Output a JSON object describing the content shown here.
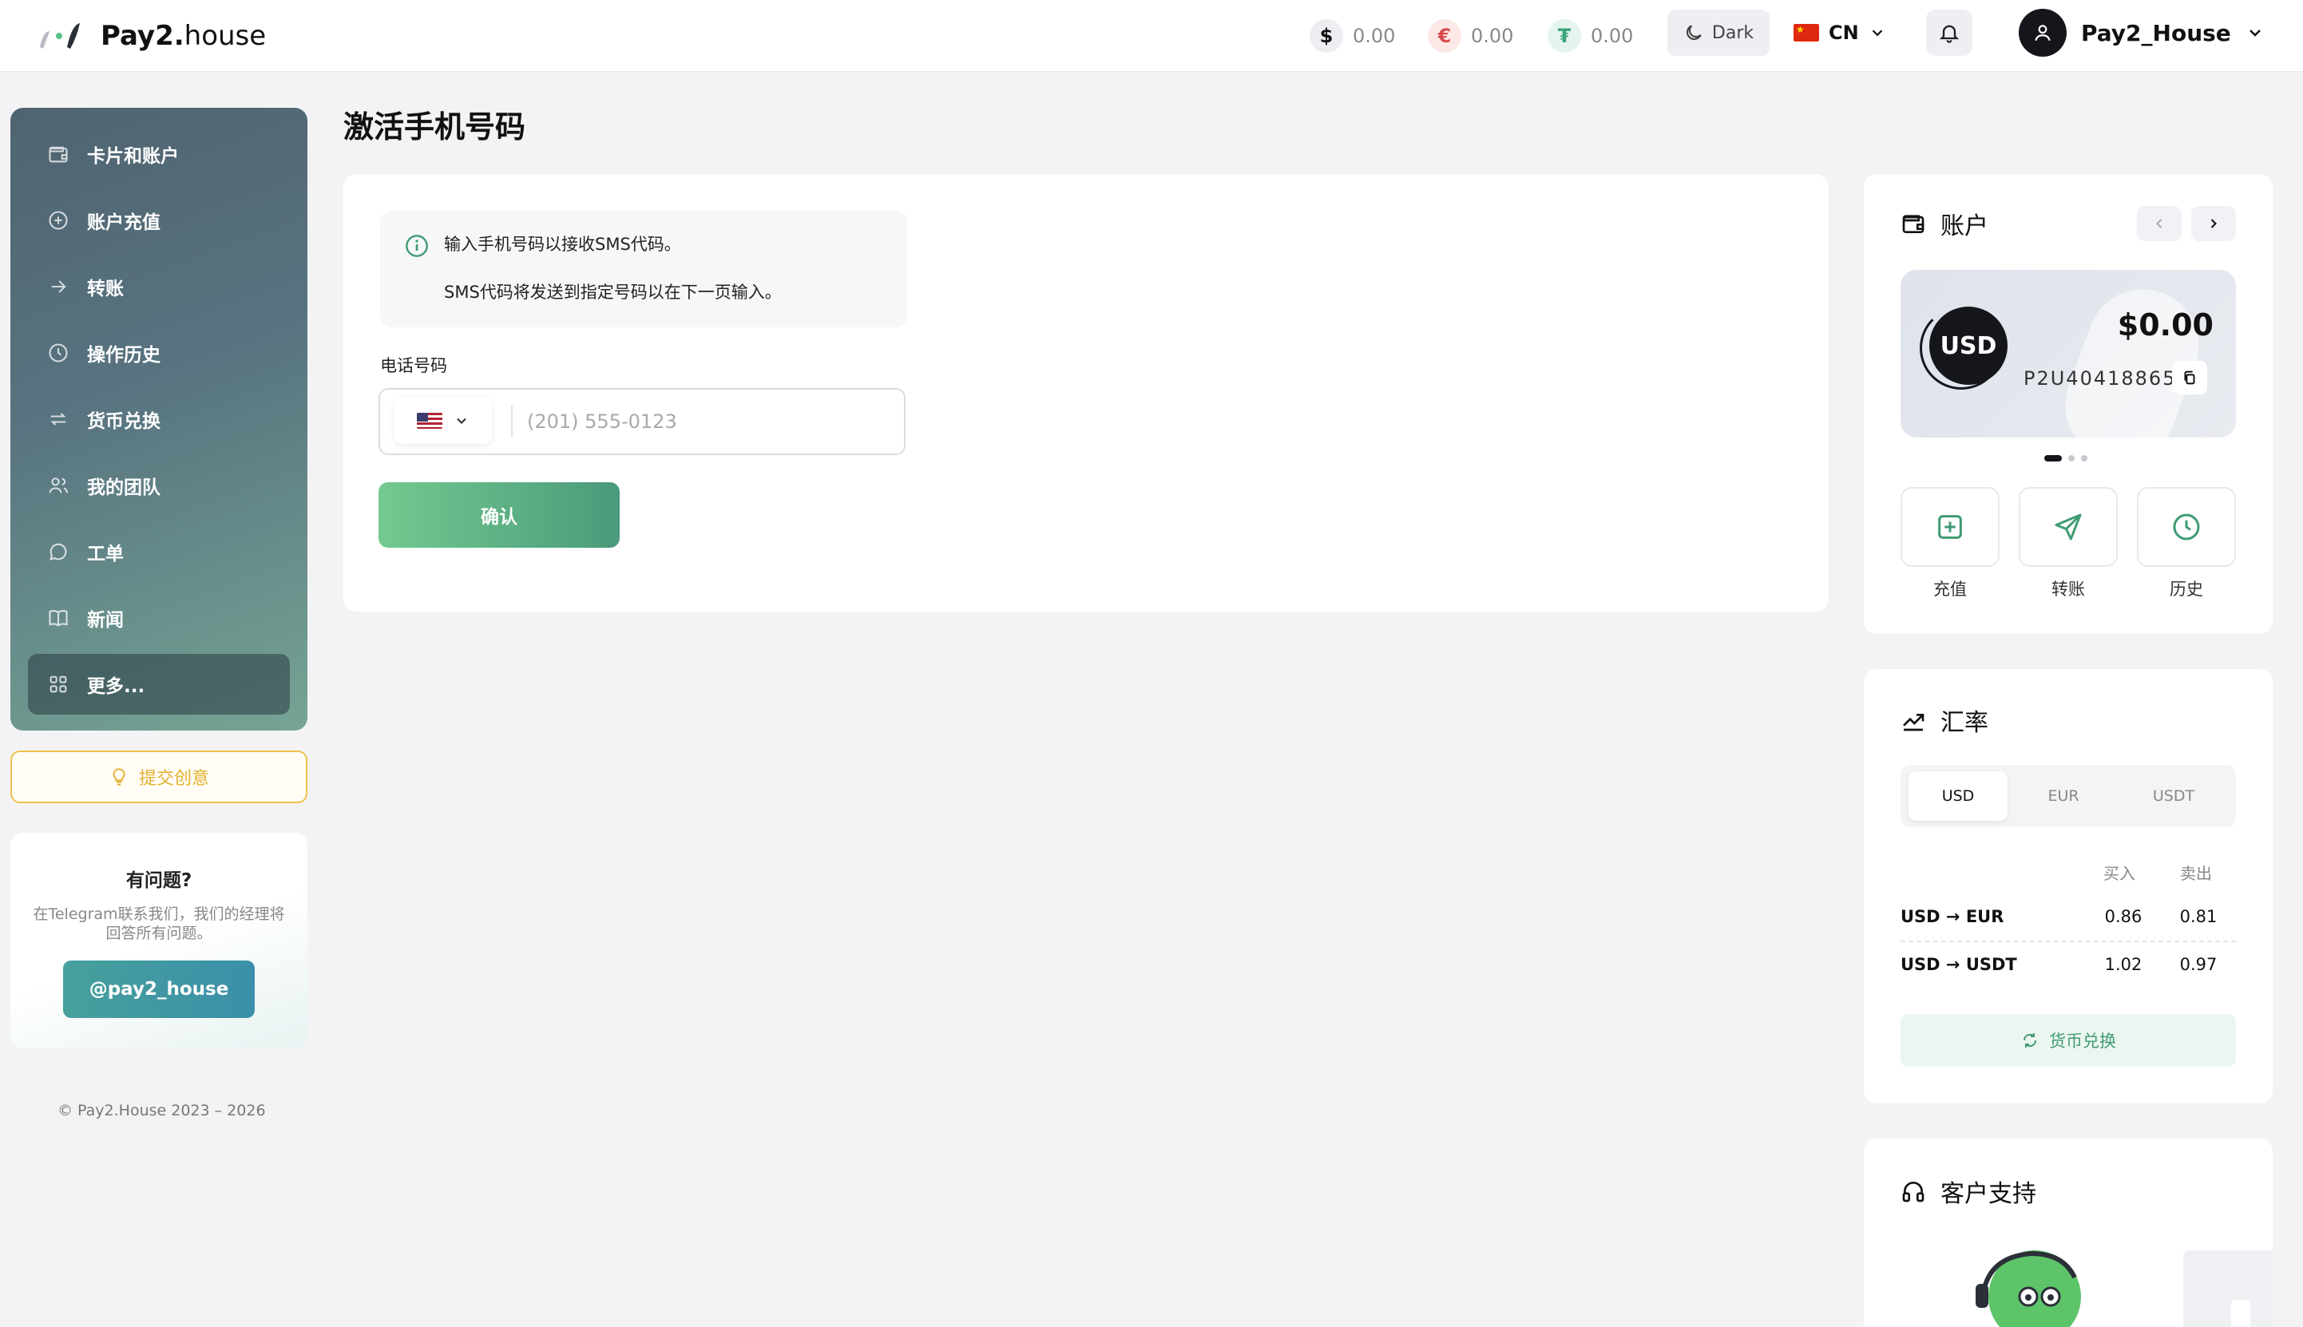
{
  "header": {
    "logo_bold": "Pay2.",
    "logo_light": "house",
    "balances": [
      {
        "symbol": "$",
        "value": "0.00",
        "bg": "#eceef2",
        "fg": "#111111"
      },
      {
        "symbol": "€",
        "value": "0.00",
        "bg": "#fde8e8",
        "fg": "#d94c4c"
      },
      {
        "symbol": "₮",
        "value": "0.00",
        "bg": "#e5f4ee",
        "fg": "#3aa37a"
      }
    ],
    "theme_label": "Dark",
    "lang_code": "CN",
    "username": "Pay2_House"
  },
  "sidebar": {
    "items": [
      {
        "label": "卡片和账户",
        "icon": "wallet-icon"
      },
      {
        "label": "账户充值",
        "icon": "plus-circle-icon"
      },
      {
        "label": "转账",
        "icon": "arrow-right-icon"
      },
      {
        "label": "操作历史",
        "icon": "clock-icon"
      },
      {
        "label": "货币兑换",
        "icon": "swap-icon"
      },
      {
        "label": "我的团队",
        "icon": "team-icon"
      },
      {
        "label": "工单",
        "icon": "chat-icon"
      },
      {
        "label": "新闻",
        "icon": "book-icon"
      },
      {
        "label": "更多...",
        "icon": "grid-icon"
      }
    ],
    "idea_label": "提交创意",
    "help_title": "有问题?",
    "help_text": "在Telegram联系我们，我们的经理将回答所有问题。",
    "help_button": "@pay2_house",
    "copyright": "© Pay2.House 2023 – 2026"
  },
  "main": {
    "title": "激活手机号码",
    "info_line1": "输入手机号码以接收SMS代码。",
    "info_line2": "SMS代码将发送到指定号码以在下一页输入。",
    "phone_label": "电话号码",
    "phone_placeholder": "(201) 555-0123",
    "phone_value": "",
    "confirm_label": "确认"
  },
  "account": {
    "title": "账户",
    "currency": "USD",
    "amount": "$0.00",
    "number": "P2U40418865",
    "actions": [
      "充值",
      "转账",
      "历史"
    ]
  },
  "rates": {
    "title": "汇率",
    "tabs": [
      "USD",
      "EUR",
      "USDT"
    ],
    "col_buy": "买入",
    "col_sell": "卖出",
    "rows": [
      {
        "pair": "USD → EUR",
        "buy": "0.86",
        "sell": "0.81"
      },
      {
        "pair": "USD → USDT",
        "buy": "1.02",
        "sell": "0.97"
      }
    ],
    "exchange_button": "货币兑换"
  },
  "support": {
    "title": "客户支持"
  },
  "colors": {
    "accent_green": "#4a9a7b",
    "sidebar_dark": "#4f6470",
    "idea_yellow": "#f0c04a"
  }
}
